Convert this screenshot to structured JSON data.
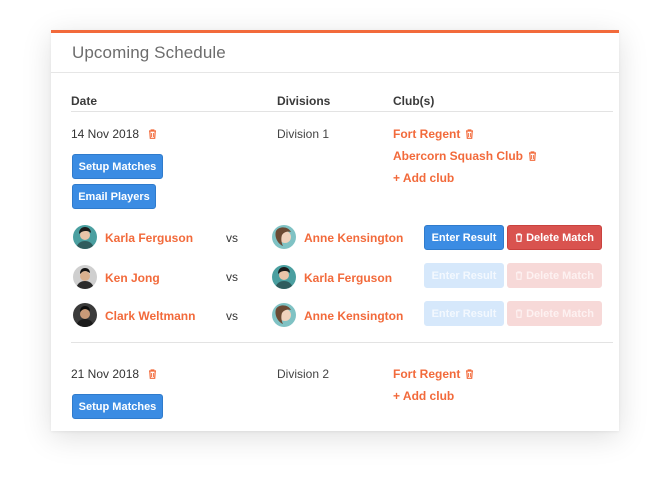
{
  "panel": {
    "title": "Upcoming Schedule"
  },
  "table": {
    "headers": {
      "date": "Date",
      "divisions": "Divisions",
      "clubs": "Club(s)"
    }
  },
  "entries": [
    {
      "date": "14 Nov 2018",
      "division": "Division 1",
      "clubs": [
        "Fort Regent",
        "Abercorn Squash Club"
      ],
      "add_club": "+ Add club",
      "setup_label": "Setup Matches",
      "email_label": "Email Players",
      "matches": [
        {
          "home": "Karla Ferguson",
          "vs": "vs",
          "away": "Anne Kensington",
          "enter_result": "Enter Result",
          "delete_match": "Delete Match",
          "enabled": true
        },
        {
          "home": "Ken Jong",
          "vs": "vs",
          "away": "Karla Ferguson",
          "enter_result": "Enter Result",
          "delete_match": "Delete Match",
          "enabled": false
        },
        {
          "home": "Clark Weltmann",
          "vs": "vs",
          "away": "Anne Kensington",
          "enter_result": "Enter Result",
          "delete_match": "Delete Match",
          "enabled": false
        }
      ]
    },
    {
      "date": "21 Nov 2018",
      "division": "Division 2",
      "clubs": [
        "Fort Regent"
      ],
      "add_club": "+ Add club",
      "setup_label": "Setup Matches"
    }
  ],
  "icons": {
    "delete": "trash-icon",
    "avatar": "avatar-icon"
  },
  "colors": {
    "accent": "#f26a3b",
    "primary": "#3b8ce3",
    "danger": "#d9534f"
  }
}
